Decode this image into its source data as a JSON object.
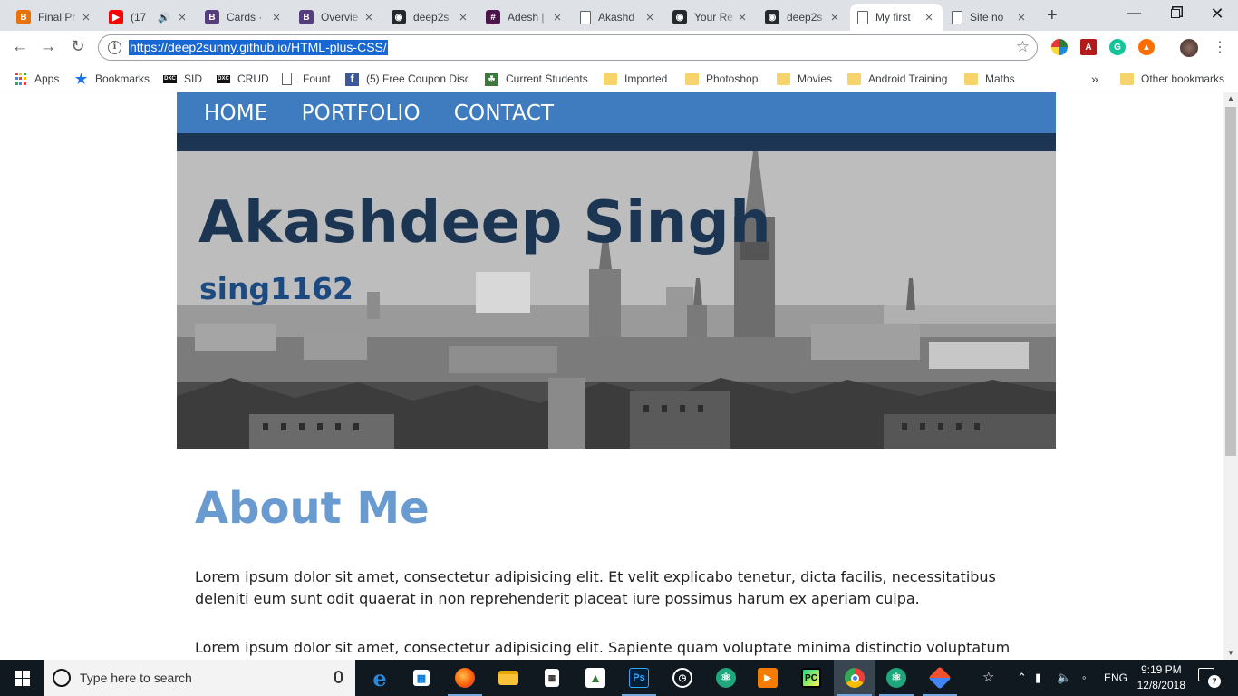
{
  "tabs": [
    {
      "title": "Final Pr",
      "favicon_color": "#e8710a",
      "favicon_glyph": "B"
    },
    {
      "title": "(17",
      "favicon_color": "#ff0000",
      "favicon_glyph": "▶",
      "audio": true
    },
    {
      "title": "Cards · ",
      "favicon_color": "#563d7c",
      "favicon_glyph": "B"
    },
    {
      "title": "Overvie",
      "favicon_color": "#563d7c",
      "favicon_glyph": "B"
    },
    {
      "title": "deep2s",
      "favicon_color": "#24292e",
      "favicon_glyph": "◉"
    },
    {
      "title": "Adesh | ",
      "favicon_color": "#4a154b",
      "favicon_glyph": "#"
    },
    {
      "title": "Akashd",
      "favicon_color": "#ffffff",
      "favicon_glyph": "▯"
    },
    {
      "title": "Your Re",
      "favicon_color": "#24292e",
      "favicon_glyph": "◉"
    },
    {
      "title": "deep2s",
      "favicon_color": "#24292e",
      "favicon_glyph": "◉"
    },
    {
      "title": "My first",
      "favicon_color": "#ffffff",
      "favicon_glyph": "▯",
      "active": true
    },
    {
      "title": "Site no",
      "favicon_color": "#ffffff",
      "favicon_glyph": "▯"
    }
  ],
  "omnibox": {
    "url": "https://deep2sunny.github.io/HTML-plus-CSS/"
  },
  "bookmarks": [
    {
      "label": "Apps",
      "icon": "apps-grid-icon"
    },
    {
      "label": "Bookmarks",
      "icon": "star-icon"
    },
    {
      "label": "SID",
      "icon": "dxc-icon"
    },
    {
      "label": "CRUD",
      "icon": "dxc-icon"
    },
    {
      "label": "Fount",
      "icon": "page-icon"
    },
    {
      "label": "(5) Free Coupon Disc",
      "icon": "facebook-icon"
    },
    {
      "label": "Current Students",
      "icon": "leaf-icon"
    },
    {
      "label": "Imported",
      "icon": "folder-icon"
    },
    {
      "label": "Photoshop",
      "icon": "folder-icon"
    },
    {
      "label": "Movies",
      "icon": "folder-icon"
    },
    {
      "label": "Android Training",
      "icon": "folder-icon"
    },
    {
      "label": "Maths",
      "icon": "folder-icon"
    }
  ],
  "bookmarks_overflow": "»",
  "other_bookmarks": "Other bookmarks",
  "site": {
    "nav": [
      "HOME",
      "PORTFOLIO",
      "CONTACT"
    ],
    "hero_title": "Akashdeep Singh",
    "hero_subtitle": "sing1162",
    "about_heading": "About Me",
    "paragraphs": [
      "Lorem ipsum dolor sit amet, consectetur adipisicing elit. Et velit explicabo tenetur, dicta facilis, necessitatibus deleniti eum sunt odit quaerat in non reprehenderit placeat iure possimus harum ex aperiam culpa.",
      "Lorem ipsum dolor sit amet, consectetur adipisicing elit. Sapiente quam voluptate minima distinctio voluptatum quo! Iure labore"
    ]
  },
  "taskbar": {
    "search_placeholder": "Type here to search",
    "language": "ENG",
    "time": "9:19 PM",
    "date": "12/8/2018",
    "notifications": "7"
  }
}
